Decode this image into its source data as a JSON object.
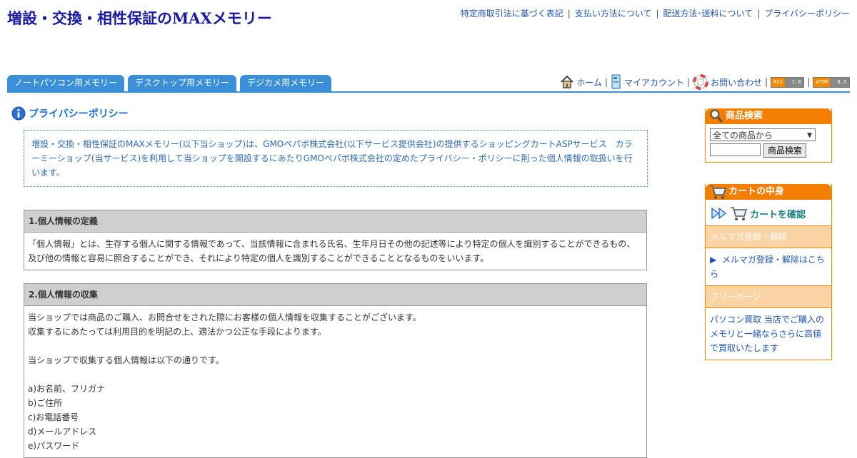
{
  "header": {
    "site_title": "増設・交換・相性保証のMAXメモリー",
    "top_links": [
      "特定商取引法に基づく表記",
      "支払い方法について",
      "配送方法･送料について",
      "プライバシーポリシー"
    ],
    "separator": "|"
  },
  "tabs": [
    "ノートパソコン用メモリー",
    "デスクトップ用メモリー",
    "デジカメ用メモリー"
  ],
  "util_nav": {
    "home": "ホーム",
    "account": "マイアカウント",
    "contact": "お問い合わせ",
    "rss_label": "RSS",
    "rss_version": "1.0",
    "atom_label": "ATOM",
    "atom_version": "0.3"
  },
  "page_heading": "プライバシーポリシー",
  "intro": "増設・交換・相性保証のMAXメモリー(以下当ショップ)は、GMOペパボ株式会社(以下サービス提供会社)の提供するショッピングカートASPサービス　カラーミーショップ(当サービス)を利用して当ショップを開設するにあたりGMOペパボ株式会社の定めたプライバシー・ポリシーに則った個人情報の取扱いを行います。",
  "sections": [
    {
      "title": "1.個人情報の定義",
      "lines": [
        "「個人情報」とは、生存する個人に関する情報であって、当該情報に含まれる氏名、生年月日その他の記述等により特定の個人を識別することができるもの、及び他の情報と容易に照合することができ、それにより特定の個人を識別することができることとなるものをいいます。"
      ]
    },
    {
      "title": "2.個人情報の収集",
      "lines": [
        "当ショップでは商品のご購入、お問合せをされた際にお客様の個人情報を収集することがございます。",
        "収集するにあたっては利用目的を明記の上、適法かつ公正な手段によります。",
        "",
        "当ショップで収集する個人情報は以下の通りです。",
        "",
        "a)お名前、フリガナ",
        "b)ご住所",
        "c)お電話番号",
        "d)メールアドレス",
        "e)パスワード"
      ]
    }
  ],
  "sidebar": {
    "search": {
      "title": "商品検索",
      "select_value": "全ての商品から",
      "button": "商品検索"
    },
    "cart": {
      "title": "カートの中身",
      "link": "カートを確認"
    },
    "mailmag": {
      "title": "メルマガ登録・解除",
      "link_arrow": "▶",
      "link": "メルマガ登録・解除はこちら"
    },
    "freepage": {
      "title": "フリーページ",
      "link": "パソコン買取 当店でご購入のメモリと一緒ならさらに高値で買取いたします"
    }
  },
  "colors": {
    "tab_blue": "#3b8fd6",
    "widget_orange": "#f37e00",
    "link_blue": "#2255aa"
  }
}
